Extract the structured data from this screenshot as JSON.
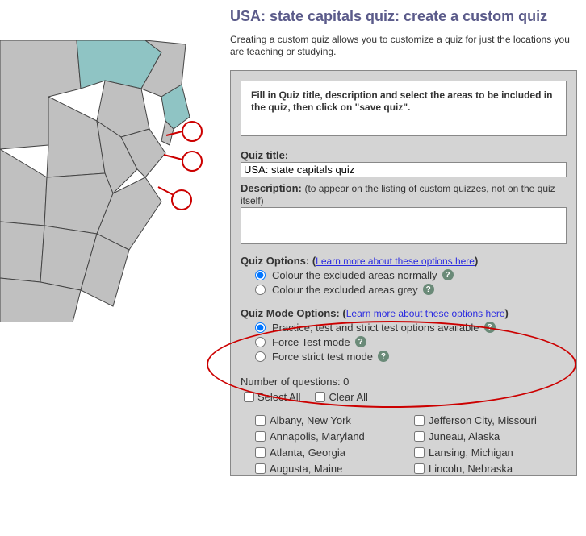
{
  "page": {
    "title": "USA: state capitals quiz: create a custom quiz",
    "intro": "Creating a custom quiz allows you to customize a quiz for just the locations you are teaching or studying."
  },
  "instruction": "Fill in Quiz title, description and select the areas to be included in the quiz, then click on \"save quiz\".",
  "form": {
    "quiz_title_label": "Quiz title:",
    "quiz_title_value": "USA: state capitals quiz",
    "description_label": "Description:",
    "description_note": "(to appear on the listing of custom quizzes, not on the quiz itself)",
    "description_value": ""
  },
  "quiz_options": {
    "heading": "Quiz Options:",
    "learn_link": "Learn more about these options here",
    "opt1": "Colour the excluded areas normally",
    "opt2": "Colour the excluded areas grey"
  },
  "mode_options": {
    "heading": "Quiz Mode Options:",
    "learn_link": "Learn more about these options here",
    "opt1": "Practice, test and strict test options available",
    "opt2": "Force Test mode",
    "opt3": "Force strict test mode"
  },
  "questions": {
    "count_label": "Number of questions: 0",
    "select_all": "Select All",
    "clear_all": "Clear All"
  },
  "locations_col1": [
    "Albany, New York",
    "Annapolis, Maryland",
    "Atlanta, Georgia",
    "Augusta, Maine"
  ],
  "locations_col2": [
    "Jefferson City, Missouri",
    "Juneau, Alaska",
    "Lansing, Michigan",
    "Lincoln, Nebraska"
  ]
}
